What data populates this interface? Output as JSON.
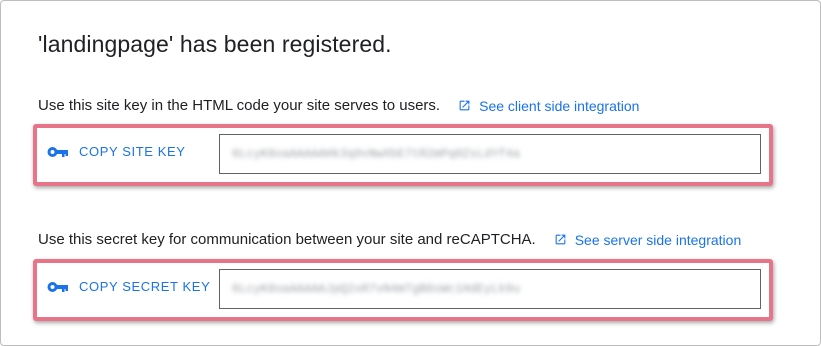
{
  "headline": "'landingpage' has been registered.",
  "site_key": {
    "description": "Use this site key in the HTML code your site serves to users.",
    "link_label": "See client side integration",
    "copy_label": "COPY SITE KEY",
    "value": "6LcyK8oaAAAAAHk3q9vNwXbE7tR2mPq0ZsLdYf4a"
  },
  "secret_key": {
    "description": "Use this secret key for communication between your site and reCAPTCHA.",
    "link_label": "See server side integration",
    "copy_label": "COPY SECRET KEY",
    "value": "6LcyK8oaAAAAAJpQ2xR7vN4mTgB8sWc1HdEyLk9u"
  },
  "icons": {
    "external_link": "open-in-new-icon",
    "key": "key-icon"
  },
  "colors": {
    "accent": "#1a73e8",
    "highlight": "#e8748a",
    "text": "#202124"
  }
}
